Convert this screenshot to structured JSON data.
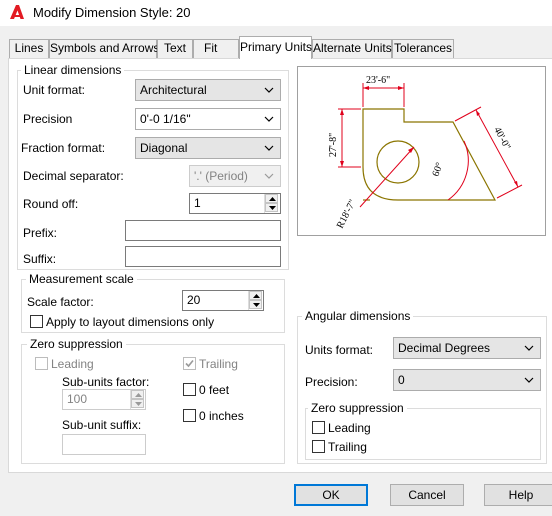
{
  "window": {
    "title": "Modify Dimension Style: 20"
  },
  "tabs": [
    {
      "label": "Lines"
    },
    {
      "label": "Symbols and Arrows"
    },
    {
      "label": "Text"
    },
    {
      "label": "Fit"
    },
    {
      "label": "Primary Units"
    },
    {
      "label": "Alternate Units"
    },
    {
      "label": "Tolerances"
    }
  ],
  "active_tab": "Primary Units",
  "linear": {
    "group_label": "Linear dimensions",
    "unit_format": {
      "label": "Unit format:",
      "value": "Architectural"
    },
    "precision": {
      "label": "Precision",
      "value": "0'-0 1/16\""
    },
    "fraction_format": {
      "label": "Fraction format:",
      "value": "Diagonal"
    },
    "decimal_separator": {
      "label": "Decimal separator:",
      "value": "'.' (Period)"
    },
    "round_off": {
      "label": "Round off:",
      "value": "1"
    },
    "prefix": {
      "label": "Prefix:",
      "value": ""
    },
    "suffix": {
      "label": "Suffix:",
      "value": ""
    }
  },
  "measurement": {
    "group_label": "Measurement scale",
    "scale_factor": {
      "label": "Scale factor:",
      "value": "20"
    },
    "apply_layout": {
      "label": "Apply to layout dimensions only",
      "checked": false
    }
  },
  "zero_linear": {
    "group_label": "Zero suppression",
    "leading": {
      "label": "Leading",
      "checked": false
    },
    "trailing": {
      "label": "Trailing",
      "checked": true
    },
    "sub_units_factor": {
      "label": "Sub-units factor:",
      "value": "100"
    },
    "sub_unit_suffix": {
      "label": "Sub-unit suffix:",
      "value": ""
    },
    "zero_feet": {
      "label": "0 feet",
      "checked": false
    },
    "zero_inches": {
      "label": "0 inches",
      "checked": false
    }
  },
  "angular": {
    "group_label": "Angular dimensions",
    "units_format": {
      "label": "Units format:",
      "value": "Decimal Degrees"
    },
    "precision": {
      "label": "Precision:",
      "value": "0"
    },
    "zero_group_label": "Zero suppression",
    "leading": {
      "label": "Leading",
      "checked": false
    },
    "trailing": {
      "label": "Trailing",
      "checked": false
    }
  },
  "preview": {
    "dim_top": "23'-6\"",
    "dim_left": "27'-8\"",
    "dim_diag": "40'-0\"",
    "dim_radius": "R18'-7\"",
    "dim_angle": "60°"
  },
  "buttons": {
    "ok": "OK",
    "cancel": "Cancel",
    "help": "Help"
  },
  "colors": {
    "accent": "#0078d7",
    "preview_geometry": "#8b7500",
    "preview_dims": "#e0001b"
  }
}
